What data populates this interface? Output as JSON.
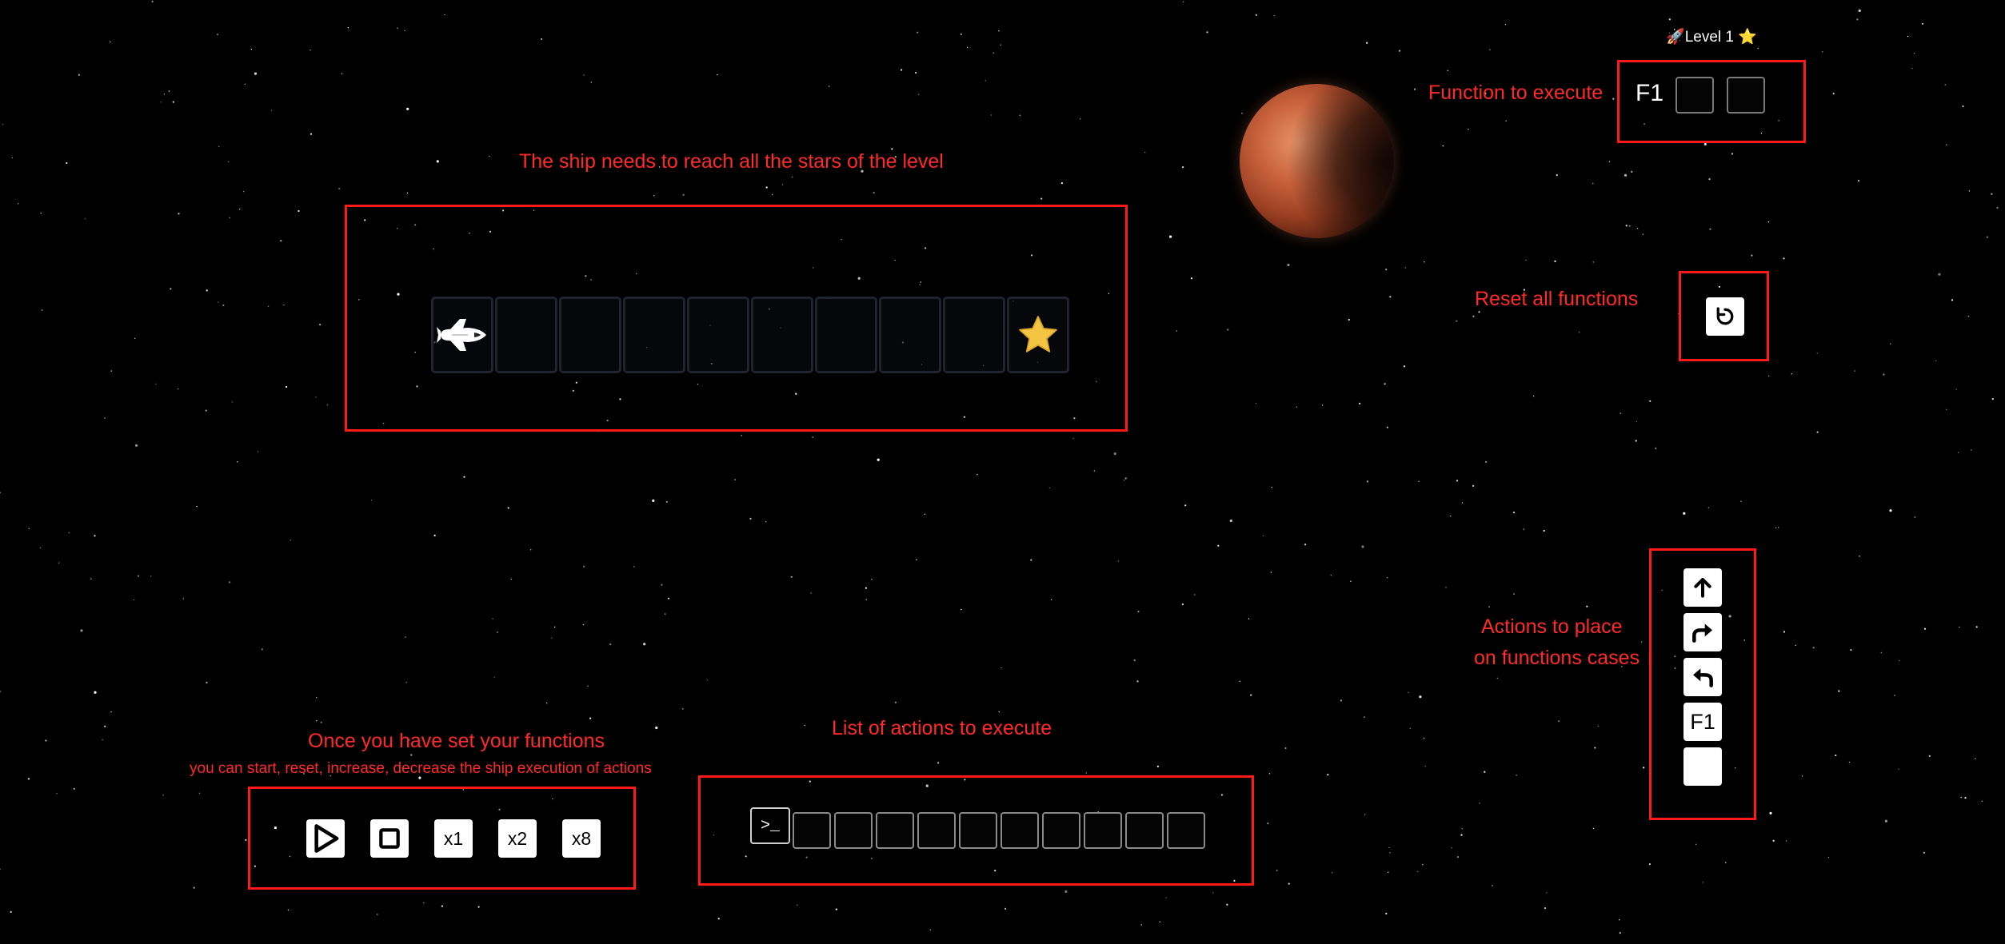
{
  "header": {
    "level_title": "🚀Level 1 ⭐"
  },
  "function_panel": {
    "name": "F1",
    "slots": [
      "",
      ""
    ]
  },
  "annotations": {
    "function_to_execute": "Function to execute",
    "ship_goal": "The ship needs to reach all the stars of the level",
    "reset_all": "Reset all functions",
    "actions_line1": "Actions to place",
    "actions_line2": "on functions cases",
    "once_set": "Once you have set your functions",
    "controls_hint": "you can start, reset, increase, decrease the ship execution of actions",
    "list_of_actions": "List of actions to execute"
  },
  "level_track": {
    "cells": [
      {
        "content": "ship",
        "icon": "space-shuttle-icon"
      },
      {
        "content": "empty"
      },
      {
        "content": "empty"
      },
      {
        "content": "empty"
      },
      {
        "content": "empty"
      },
      {
        "content": "empty"
      },
      {
        "content": "empty"
      },
      {
        "content": "empty"
      },
      {
        "content": "empty"
      },
      {
        "content": "star",
        "icon": "star-icon"
      }
    ]
  },
  "reset_button": {
    "icon": "reset-icon"
  },
  "action_palette": {
    "items": [
      {
        "name": "forward",
        "icon": "arrow-up-icon",
        "label": ""
      },
      {
        "name": "turn-right",
        "icon": "turn-right-icon",
        "label": ""
      },
      {
        "name": "turn-left",
        "icon": "turn-left-icon",
        "label": ""
      },
      {
        "name": "call-f1",
        "icon": "",
        "label": "F1"
      },
      {
        "name": "empty",
        "icon": "",
        "label": ""
      }
    ]
  },
  "controls": {
    "play_icon": "play-icon",
    "stop_icon": "stop-icon",
    "speeds": [
      "x1",
      "x2",
      "x8"
    ]
  },
  "execution_list": {
    "prompt": ">_",
    "slots": [
      "",
      "",
      "",
      "",
      "",
      "",
      "",
      "",
      "",
      ""
    ]
  },
  "colors": {
    "annotation_red": "#ff2a2a",
    "background": "#000000",
    "star_yellow": "#f4c542"
  }
}
